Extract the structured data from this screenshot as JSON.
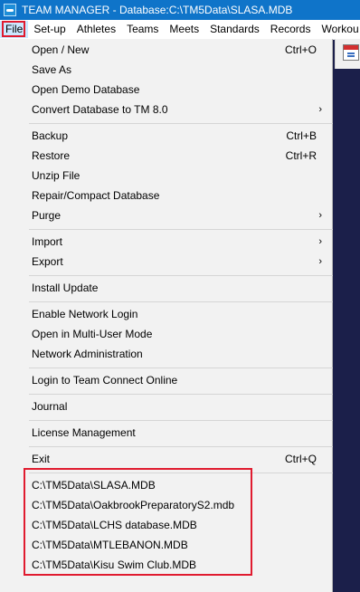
{
  "window": {
    "title": "TEAM MANAGER - Database:C:\\TM5Data\\SLASA.MDB"
  },
  "menubar": {
    "items": [
      {
        "label": "File"
      },
      {
        "label": "Set-up"
      },
      {
        "label": "Athletes"
      },
      {
        "label": "Teams"
      },
      {
        "label": "Meets"
      },
      {
        "label": "Standards"
      },
      {
        "label": "Records"
      },
      {
        "label": "Workou"
      }
    ]
  },
  "file_menu": {
    "open_new": {
      "label": "Open / New",
      "shortcut": "Ctrl+O"
    },
    "save_as": {
      "label": "Save As"
    },
    "open_demo": {
      "label": "Open Demo Database"
    },
    "convert": {
      "label": "Convert Database to TM 8.0",
      "arrow": "›"
    },
    "backup": {
      "label": "Backup",
      "shortcut": "Ctrl+B"
    },
    "restore": {
      "label": "Restore",
      "shortcut": "Ctrl+R"
    },
    "unzip": {
      "label": "Unzip File"
    },
    "repair": {
      "label": "Repair/Compact Database"
    },
    "purge": {
      "label": "Purge",
      "arrow": "›"
    },
    "import": {
      "label": "Import",
      "arrow": "›"
    },
    "export": {
      "label": "Export",
      "arrow": "›"
    },
    "install_update": {
      "label": "Install Update"
    },
    "enable_network_login": {
      "label": "Enable Network Login"
    },
    "open_multi_user": {
      "label": "Open in Multi-User Mode"
    },
    "network_admin": {
      "label": "Network Administration"
    },
    "login_team_connect": {
      "label": "Login to Team Connect Online"
    },
    "journal": {
      "label": "Journal"
    },
    "license_management": {
      "label": "License Management"
    },
    "exit": {
      "label": "Exit",
      "shortcut": "Ctrl+Q"
    },
    "recent_files": [
      "C:\\TM5Data\\SLASA.MDB",
      "C:\\TM5Data\\OakbrookPreparatoryS2.mdb",
      "C:\\TM5Data\\LCHS database.MDB",
      "C:\\TM5Data\\MTLEBANON.MDB",
      "C:\\TM5Data\\Kisu Swim Club.MDB"
    ]
  },
  "colors": {
    "titlebar": "#0f74c9",
    "menu_background": "#f2f2f2",
    "highlight_box": "#e01b2f",
    "app_background": "#1b1f4a"
  }
}
